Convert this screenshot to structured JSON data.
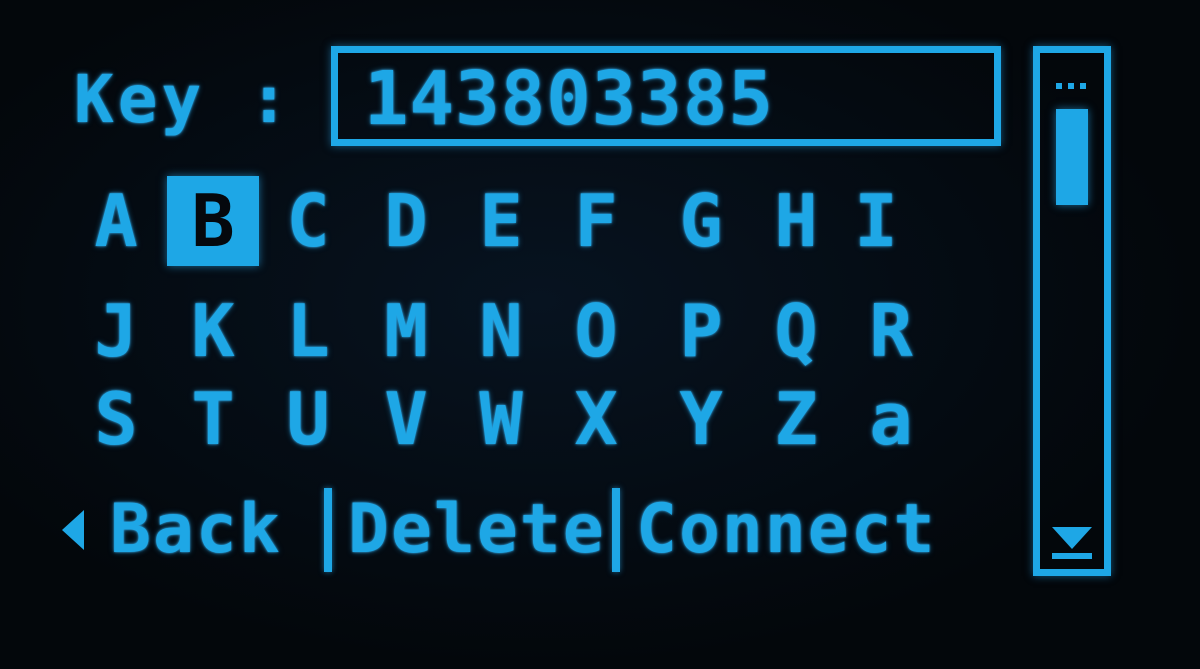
{
  "key_label": "Key :",
  "key_value": "143803385",
  "keyboard": {
    "selected": "B",
    "rows": [
      [
        "A",
        "B",
        "C",
        "D",
        "E",
        "F",
        "G",
        "H",
        "I"
      ],
      [
        "J",
        "K",
        "L",
        "M",
        "N",
        "O",
        "P",
        "Q",
        "R"
      ],
      [
        "S",
        "T",
        "U",
        "V",
        "W",
        "X",
        "Y",
        "Z",
        "a"
      ]
    ]
  },
  "actions": {
    "back": "Back",
    "delete": "Delete",
    "connect": "Connect"
  },
  "scrollbar": {
    "position": 0
  },
  "colors": {
    "accent": "#1ea7e6",
    "background": "#04070c"
  },
  "icons": {
    "back": "triangle-left-icon",
    "scroll_down": "triangle-down-icon"
  }
}
